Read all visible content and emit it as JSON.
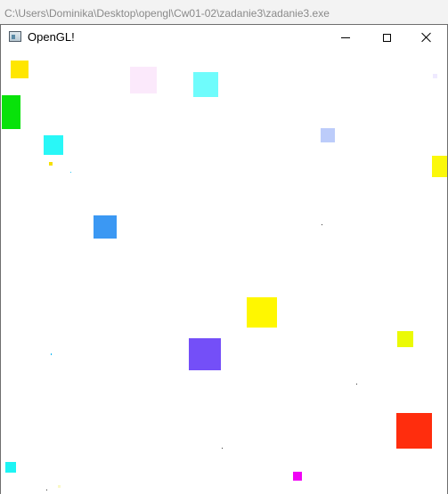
{
  "console": {
    "path": "C:\\Users\\Dominika\\Desktop\\opengl\\Cw01-02\\zadanie3\\zadanie3.exe"
  },
  "window": {
    "title": "OpenGL!",
    "icon": "application-window-icon",
    "controls": {
      "minimize": "minimize-icon",
      "maximize": "maximize-icon",
      "close": "close-icon"
    }
  },
  "scene": {
    "background": "#ffffff",
    "squares": [
      {
        "color": "#ffe600"
      },
      {
        "color": "#fbe9fb"
      },
      {
        "color": "#6ffcfc"
      },
      {
        "color": "#08e20a"
      },
      {
        "color": "#29f7f7"
      },
      {
        "color": "#bcccfa"
      },
      {
        "color": "#fbf80a"
      },
      {
        "color": "#3b98f3"
      },
      {
        "color": "#fff700"
      },
      {
        "color": "#744ff8"
      },
      {
        "color": "#ebfa05"
      },
      {
        "color": "#ff2d0d"
      },
      {
        "color": "#1df4f4"
      },
      {
        "color": "#f003f5"
      }
    ],
    "specks": [
      {
        "color": "#f6e000"
      },
      {
        "color": "#efeaff"
      },
      {
        "color": "#2fc5f5"
      },
      {
        "color": "#333333"
      },
      {
        "color": "#333333"
      },
      {
        "color": "#0eb7f5"
      },
      {
        "color": "#333333"
      },
      {
        "color": "#333333"
      },
      {
        "color": "#faf8c6"
      }
    ]
  }
}
